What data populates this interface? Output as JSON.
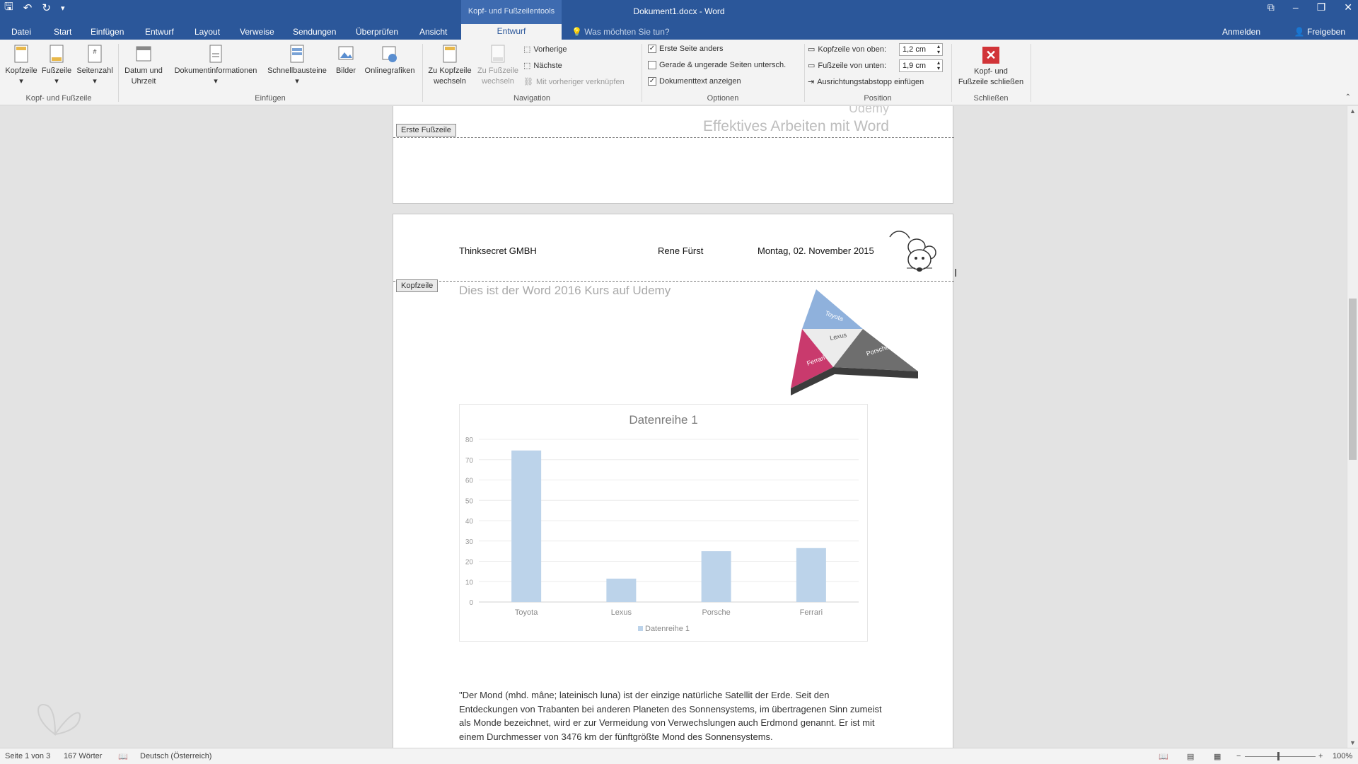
{
  "titlebar": {
    "context_tab_label": "Kopf- und Fußzeilentools",
    "doc_title": "Dokument1.docx - Word",
    "qat": {
      "save_icon": "save-icon",
      "undo_icon": "undo-icon",
      "redo_icon": "redo-icon"
    }
  },
  "tabs": [
    "Datei",
    "Start",
    "Einfügen",
    "Entwurf",
    "Layout",
    "Verweise",
    "Sendungen",
    "Überprüfen",
    "Ansicht"
  ],
  "active_tab": "Entwurf",
  "tell_me": "Was möchten Sie tun?",
  "signin": "Anmelden",
  "share": "Freigeben",
  "ribbon": {
    "group1": {
      "label": "Kopf- und Fußzeile",
      "buttons": [
        "Kopfzeile",
        "Fußzeile",
        "Seitenzahl"
      ]
    },
    "group2": {
      "label": "Einfügen",
      "datum_line1": "Datum und",
      "datum_line2": "Uhrzeit",
      "dokinfo": "Dokumentinformationen",
      "schnell": "Schnellbausteine",
      "bilder": "Bilder",
      "online": "Onlinegrafiken"
    },
    "group3": {
      "label": "Navigation",
      "zu_kopf_line1": "Zu Kopfzeile",
      "zu_kopf_line2": "wechseln",
      "zu_fuss_line1": "Zu Fußzeile",
      "zu_fuss_line2": "wechseln",
      "vorherige": "Vorherige",
      "naechste": "Nächste",
      "verknuepfen": "Mit vorheriger verknüpfen"
    },
    "group4": {
      "label": "Optionen",
      "erste_seite": "Erste Seite anders",
      "gerade": "Gerade & ungerade Seiten untersch.",
      "doktext": "Dokumenttext anzeigen"
    },
    "group5": {
      "label": "Position",
      "kopf_label": "Kopfzeile von oben:",
      "kopf_value": "1,2 cm",
      "fuss_label": "Fußzeile von unten:",
      "fuss_value": "1,9 cm",
      "tabstopp": "Ausrichtungstabstopp einfügen"
    },
    "group6": {
      "label": "Schließen",
      "close_line1": "Kopf- und",
      "close_line2": "Fußzeile schließen"
    }
  },
  "page1": {
    "udemy": "Udemy",
    "footer_text": "Effektives  Arbeiten mit Word",
    "footer_tag": "Erste Fußzeile"
  },
  "page2": {
    "header_company": "Thinksecret GMBH",
    "header_name": "Rene Fürst",
    "header_date": "Montag, 02. November 2015",
    "header_tag": "Kopfzeile",
    "intro": "Dies ist der Word 2016 Kurs auf Udemy",
    "pyramid": {
      "top": "Toyota",
      "center": "Lexus",
      "left": "Ferrari",
      "right": "Porsche"
    },
    "paragraph_lines": [
      "\"Der Mond (mhd. mâne; lateinisch luna) ist der einzige natürliche Satellit der Erde. Seit den",
      "Entdeckungen von Trabanten bei anderen Planeten des Sonnensystems, im übertragenen Sinn zumeist",
      "als Monde bezeichnet, wird er zur Vermeidung von Verwechslungen auch Erdmond genannt. Er ist mit",
      "einem Durchmesser von 3476 km der fünftgrößte Mond des Sonnensystems."
    ]
  },
  "chart_data": {
    "type": "bar",
    "title": "Datenreihe 1",
    "categories": [
      "Toyota",
      "Lexus",
      "Porsche",
      "Ferrari"
    ],
    "series": [
      {
        "name": "Datenreihe 1",
        "values": [
          74.5,
          11.5,
          25,
          26.5
        ]
      }
    ],
    "ylim": [
      0,
      80
    ],
    "yticks": [
      "0",
      "10",
      "20",
      "30",
      "40",
      "50",
      "60",
      "70",
      "80"
    ],
    "legend": "bottom",
    "grid": true,
    "bar_color": "#bcd3ea"
  },
  "status": {
    "page": "Seite 1 von 3",
    "words": "167 Wörter",
    "language": "Deutsch (Österreich)",
    "zoom": "100%"
  },
  "colors": {
    "brand": "#2b579a",
    "close": "#d13438"
  }
}
